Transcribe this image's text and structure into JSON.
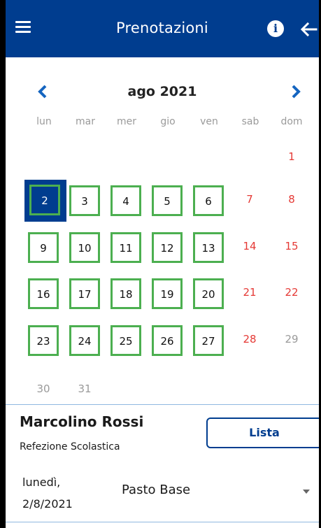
{
  "header": {
    "title": "Prenotazioni",
    "info_icon": "info-icon",
    "info_glyph": "i"
  },
  "calendar": {
    "month_label": "ago 2021",
    "weekdays": [
      "lun",
      "mar",
      "mer",
      "gio",
      "ven",
      "sab",
      "dom"
    ],
    "days": [
      "1",
      "2",
      "3",
      "4",
      "5",
      "6",
      "7",
      "8",
      "9",
      "10",
      "11",
      "12",
      "13",
      "14",
      "15",
      "16",
      "17",
      "18",
      "19",
      "20",
      "21",
      "22",
      "23",
      "24",
      "25",
      "26",
      "27",
      "28",
      "29",
      "30",
      "31"
    ],
    "selected_day": "2",
    "colors": {
      "accent": "#003d8f",
      "booked_border": "#4caf50",
      "weekend": "#e53935",
      "muted": "#9a9a9a"
    }
  },
  "booking": {
    "student_name": "Marcolino Rossi",
    "service": "Refezione Scolastica",
    "list_button": "Lista",
    "date_weekday": "lunedì,",
    "date_value": "2/8/2021",
    "meal_selected": "Pasto Base"
  }
}
